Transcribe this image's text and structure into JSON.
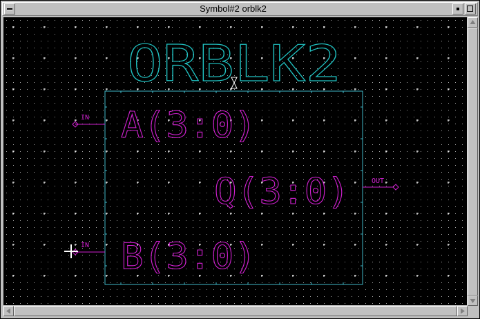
{
  "window": {
    "title": "Symbol#2 orblk2"
  },
  "symbol": {
    "name": "ORBLK2",
    "colors": {
      "name": "#20c0c0",
      "body": "#40b8c8",
      "pins": "#d020d0",
      "grid": "#a8a8a8",
      "background": "#000000",
      "cursor": "#ffffff"
    },
    "pins": [
      {
        "type": "IN",
        "label": "A(3:0)",
        "side": "left"
      },
      {
        "type": "IN",
        "label": "B(3:0)",
        "side": "left"
      },
      {
        "type": "OUT",
        "label": "Q(3:0)",
        "side": "right"
      }
    ]
  },
  "icons": {
    "window_menu": "window-menu-icon",
    "minimize": "minimize-icon",
    "maximize": "maximize-icon",
    "origin": "origin-marker-icon",
    "cursor": "crosshair-cursor-icon"
  }
}
